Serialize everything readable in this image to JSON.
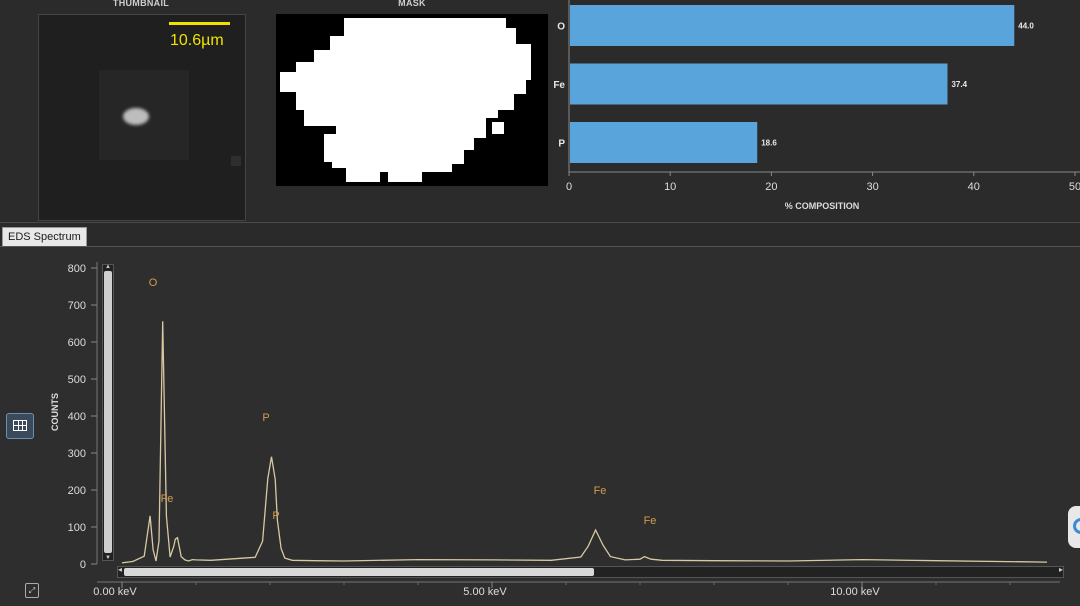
{
  "thumbnail": {
    "label": "THUMBNAIL",
    "scale_label": "10.6µm"
  },
  "mask": {
    "label": "MASK"
  },
  "composition_chart": {
    "xlabel": "% COMPOSITION",
    "ticks": [
      "0",
      "10",
      "20",
      "30",
      "40",
      "50"
    ],
    "bar_color": "#5aa4dc"
  },
  "tabs": {
    "eds": "EDS Spectrum"
  },
  "spectrum": {
    "ylabel": "COUNTS",
    "yticks": [
      "800",
      "700",
      "600",
      "500",
      "400",
      "300",
      "200",
      "100",
      "0"
    ],
    "xticks": [
      "0.00 keV",
      "5.00 keV",
      "10.00 keV"
    ],
    "line_color": "#d9c9a3",
    "peak_label_color": "#d39c4e",
    "peak_labels": [
      "O",
      "Fe",
      "P",
      "P",
      "Fe",
      "Fe"
    ]
  },
  "chart_data": [
    {
      "type": "bar",
      "orientation": "horizontal",
      "categories": [
        "O",
        "Fe",
        "P"
      ],
      "values": [
        44.0,
        37.4,
        18.6
      ],
      "data_labels": [
        "44.0",
        "37.4",
        "18.6"
      ],
      "xlabel": "% COMPOSITION",
      "xlim": [
        0,
        50
      ],
      "grid": false
    },
    {
      "type": "line",
      "xlabel": "keV",
      "ylabel": "COUNTS",
      "xlim": [
        0,
        12.5
      ],
      "ylim": [
        0,
        800
      ],
      "x": [
        0,
        0.15,
        0.3,
        0.38,
        0.42,
        0.46,
        0.5,
        0.55,
        0.6,
        0.65,
        0.7,
        0.72,
        0.75,
        0.8,
        0.85,
        0.9,
        0.95,
        1.0,
        1.2,
        1.5,
        1.8,
        1.9,
        1.97,
        2.02,
        2.07,
        2.1,
        2.15,
        2.2,
        2.3,
        2.6,
        3.0,
        4.0,
        5.0,
        5.8,
        6.2,
        6.3,
        6.4,
        6.5,
        6.6,
        6.8,
        7.0,
        7.06,
        7.15,
        7.3,
        8.0,
        9.0,
        10.0,
        11.0,
        12.5
      ],
      "y": [
        5,
        5,
        20,
        130,
        40,
        10,
        60,
        655,
        130,
        20,
        50,
        65,
        70,
        20,
        12,
        10,
        10,
        10,
        10,
        15,
        20,
        60,
        230,
        290,
        230,
        120,
        40,
        15,
        10,
        10,
        10,
        10,
        10,
        10,
        20,
        50,
        90,
        50,
        20,
        12,
        15,
        18,
        12,
        10,
        10,
        10,
        10,
        8,
        5
      ]
    }
  ]
}
